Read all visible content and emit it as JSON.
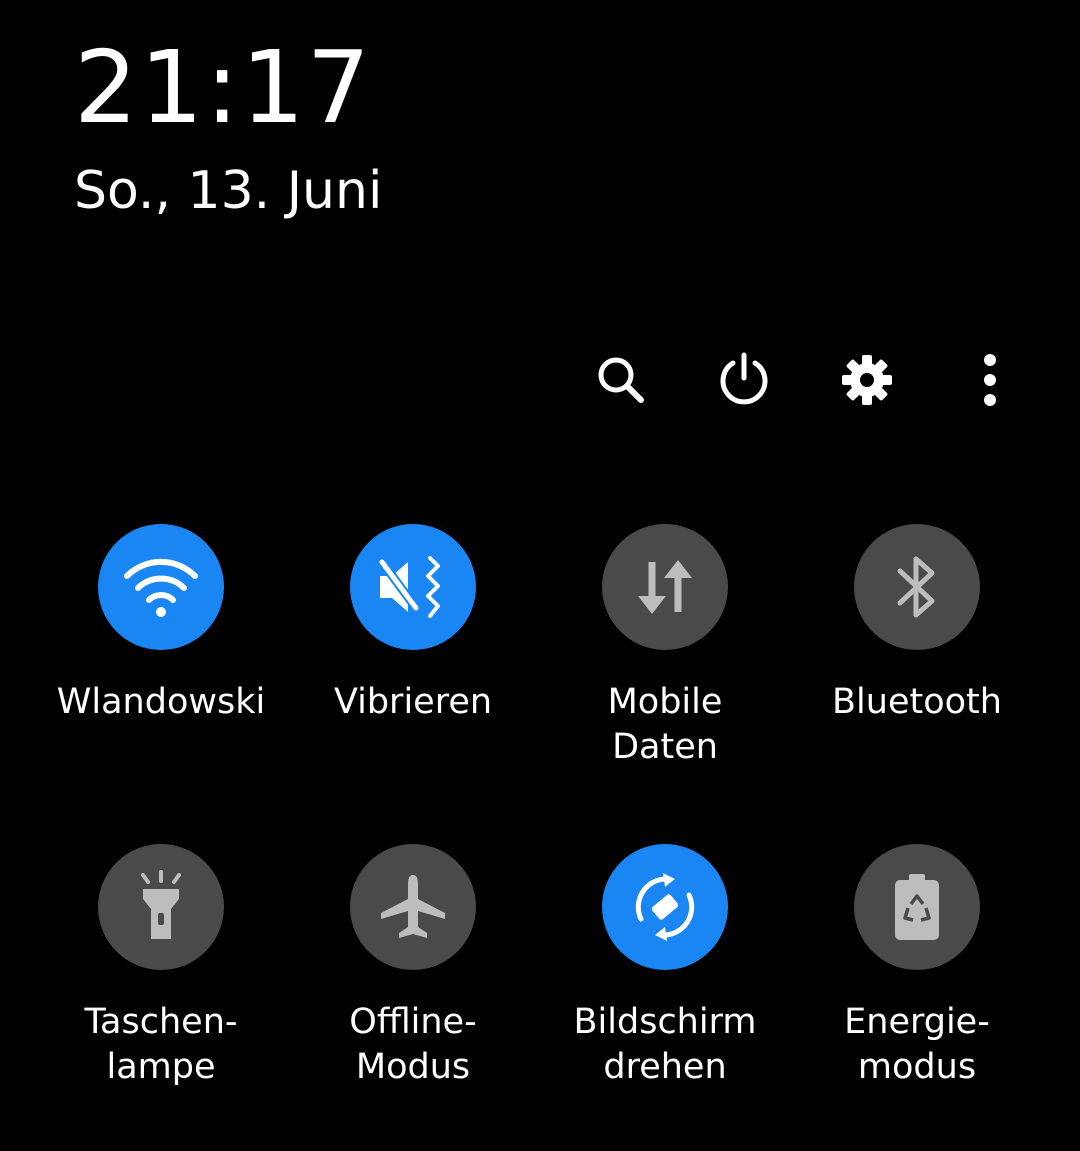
{
  "header": {
    "time": "21:17",
    "date": "So., 13. Juni"
  },
  "toolbar": {
    "items": [
      {
        "icon": "search-icon"
      },
      {
        "icon": "power-icon"
      },
      {
        "icon": "gear-icon"
      },
      {
        "icon": "more-vertical-icon"
      }
    ]
  },
  "tiles": [
    {
      "label": "Wlandowski",
      "icon": "wifi-icon",
      "active": true
    },
    {
      "label": "Vibrieren",
      "icon": "vibrate-mute-icon",
      "active": true
    },
    {
      "label": "Mobile\nDaten",
      "icon": "mobile-data-icon",
      "active": false
    },
    {
      "label": "Bluetooth",
      "icon": "bluetooth-icon",
      "active": false
    },
    {
      "label": "Taschen-\nlampe",
      "icon": "flashlight-icon",
      "active": false
    },
    {
      "label": "Offline-\nModus",
      "icon": "airplane-icon",
      "active": false
    },
    {
      "label": "Bildschirm\ndrehen",
      "icon": "auto-rotate-icon",
      "active": true
    },
    {
      "label": "Energie-\nmodus",
      "icon": "power-saving-icon",
      "active": false
    }
  ],
  "colors": {
    "active": "#1a86f3",
    "inactive": "#4a4a4a",
    "inactive_icon": "#bdbdbd",
    "background": "#000000"
  }
}
